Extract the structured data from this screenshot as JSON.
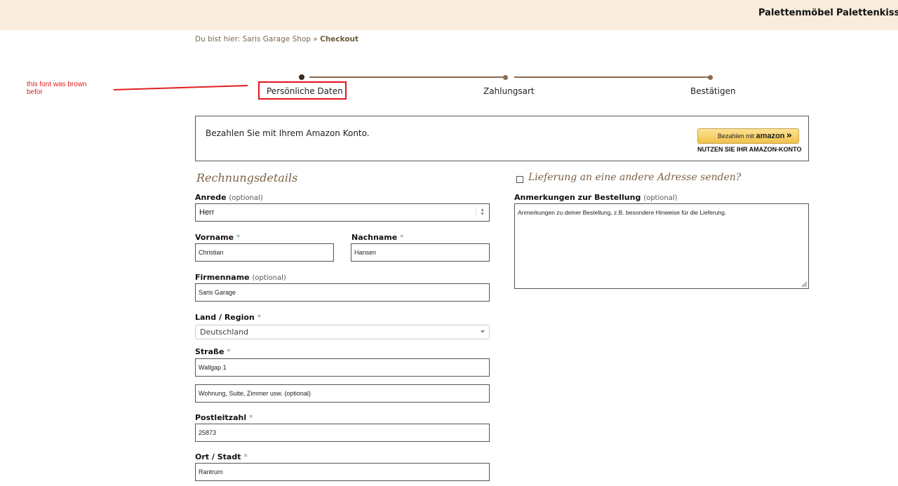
{
  "topnav": {
    "items": [
      "Palettenmöbel",
      "Palettenkissen"
    ]
  },
  "breadcrumb": {
    "prefix": "Du bist hier:",
    "shop": "Saris Garage Shop",
    "separator": "»",
    "current": "Checkout"
  },
  "annotation": {
    "text": "this font was brown befor",
    "color": "#e02020"
  },
  "steps": [
    {
      "label": "Persönliche Daten"
    },
    {
      "label": "Zahlungsart"
    },
    {
      "label": "Bestätigen"
    }
  ],
  "amazon": {
    "text": "Bezahlen Sie mit Ihrem Amazon Konto.",
    "button_prefix": "Bezahlen mit",
    "button_brand": "amazon",
    "button_arrow": "»",
    "sub": "NUTZEN SIE IHR AMAZON-KONTO"
  },
  "billing": {
    "title": "Rechnungsdetails",
    "anrede": {
      "label": "Anrede",
      "optional": "(optional)",
      "value": "Herr"
    },
    "vorname": {
      "label": "Vorname",
      "req": "*",
      "value": "Christian"
    },
    "nachname": {
      "label": "Nachname",
      "req": "*",
      "value": "Hansen"
    },
    "firma": {
      "label": "Firmenname",
      "optional": "(optional)",
      "value": "Saris Garage"
    },
    "land": {
      "label": "Land / Region",
      "req": "*",
      "value": "Deutschland"
    },
    "strasse": {
      "label": "Straße",
      "req": "*",
      "value": "Wallgap 1",
      "placeholder2": "Wohnung, Suite, Zimmer usw. (optional)"
    },
    "plz": {
      "label": "Postleitzahl",
      "req": "*",
      "value": "25873"
    },
    "ort": {
      "label": "Ort / Stadt",
      "req": "*",
      "value": "Rantrum"
    }
  },
  "shipping": {
    "toggle_label": "Lieferung an eine andere Adresse senden?",
    "notes_label": "Anmerkungen zur Bestellung",
    "notes_optional": "(optional)",
    "notes_placeholder": "Anmerkungen zu deiner Bestellung, z.B. besondere Hinweise für die Lieferung."
  },
  "colors": {
    "topbar": "#f9ecdc",
    "accent_brown": "#8a6b4f",
    "highlight_red": "#e0141e",
    "required_star": "#6a9f8a"
  }
}
